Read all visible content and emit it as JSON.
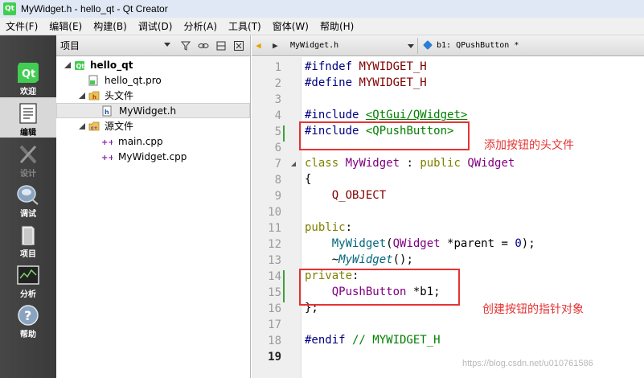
{
  "window": {
    "title": "MyWidget.h - hello_qt - Qt Creator",
    "app_icon": "Qt"
  },
  "menu": [
    "文件(F)",
    "编辑(E)",
    "构建(B)",
    "调试(D)",
    "分析(A)",
    "工具(T)",
    "窗体(W)",
    "帮助(H)"
  ],
  "modes": [
    {
      "label": "欢迎",
      "icon": "qt-logo-icon"
    },
    {
      "label": "编辑",
      "icon": "edit-document-icon"
    },
    {
      "label": "设计",
      "icon": "design-brush-icon"
    },
    {
      "label": "调试",
      "icon": "debug-bug-icon"
    },
    {
      "label": "项目",
      "icon": "project-folder-icon"
    },
    {
      "label": "分析",
      "icon": "analyze-chart-icon"
    },
    {
      "label": "帮助",
      "icon": "help-question-icon"
    }
  ],
  "project_pane": {
    "title": "项目",
    "tree": [
      {
        "label": "hello_qt",
        "icon": "qt-project-icon"
      },
      {
        "label": "hello_qt.pro",
        "icon": "pro-file-icon"
      },
      {
        "label": "头文件",
        "icon": "header-folder-icon"
      },
      {
        "label": "MyWidget.h",
        "icon": "header-file-icon"
      },
      {
        "label": "源文件",
        "icon": "source-folder-icon"
      },
      {
        "label": "main.cpp",
        "icon": "cpp-file-icon"
      },
      {
        "label": "MyWidget.cpp",
        "icon": "cpp-file-icon"
      }
    ]
  },
  "editor_toolbar": {
    "file": "MyWidget.h",
    "symbol": "b1: QPushButton *"
  },
  "line_numbers": [
    "1",
    "2",
    "3",
    "4",
    "5",
    "6",
    "7",
    "8",
    "9",
    "10",
    "11",
    "12",
    "13",
    "14",
    "15",
    "16",
    "17",
    "18",
    "19"
  ],
  "code": {
    "l1_pp": "#ifndef",
    "l1_mac": " MYWIDGET_H",
    "l2_pp": "#define",
    "l2_mac": " MYWIDGET_H",
    "l4_pp": "#include",
    "l4_inc": "<QtGui/QWidget>",
    "l5_pp": "#include",
    "l5_inc": "<QPushButton>",
    "l7_kw": "class",
    "l7_name": "MyWidget",
    "l7_colon": " : ",
    "l7_kw2": "public",
    "l7_base": "QWidget",
    "l8": "{",
    "l9": "Q_OBJECT",
    "l11_kw": "public",
    "l11_colon": ":",
    "l12_fn": "MyWidget",
    "l12_open": "(",
    "l12_ty": "QWidget",
    "l12_rest": " *parent = ",
    "l12_num": "0",
    "l12_end": ");",
    "l13_tilde": "~",
    "l13_fn": "MyWidget",
    "l13_end": "();",
    "l14_kw": "private",
    "l14_colon": ":",
    "l15_ty": "QPushButton",
    "l15_rest": " *b1;",
    "l17": "};",
    "l19_pp": "#endif",
    "l19_com": " // MYWIDGET_H"
  },
  "annotations": {
    "include_note": "添加按钮的头文件",
    "pointer_note": "创建按钮的指针对象"
  },
  "watermark": "https://blog.csdn.net/u010761586",
  "colors": {
    "annotation": "#e53333",
    "keyword": "#808000",
    "type": "#800080",
    "include": "#008000",
    "preprocessor": "#000080"
  }
}
